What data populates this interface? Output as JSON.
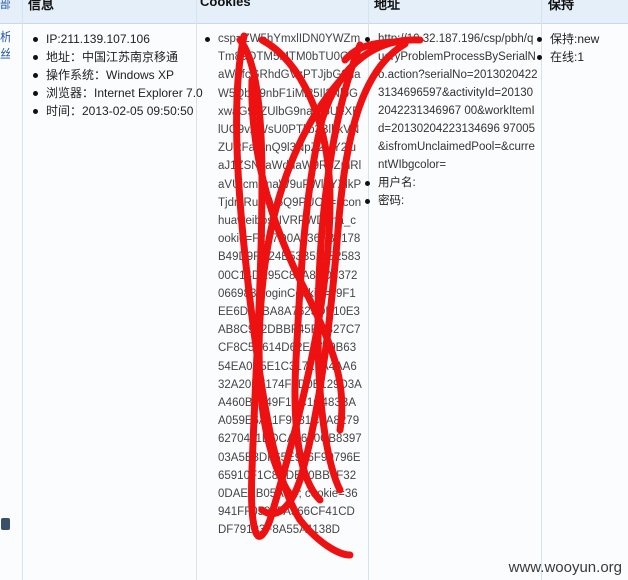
{
  "header": {
    "col_info": "信息",
    "col_cookies": "Cookies",
    "col_address": "地址",
    "col_keep": "保持"
  },
  "left_links": [
    "部",
    "析",
    "丝"
  ],
  "info": [
    "IP:211.139.107.106",
    "地址：中国江苏南京移通",
    "操作系统：Windows XP",
    "浏览器：Internet Explorer 7.0",
    "时间：2013-02-05 09:50:50"
  ],
  "cookies": "csp=ZW5hYmxlIDN0YWZmTm89OTM5MTM0bTU0G9naW5fcGRhdGVzPTJjbG9naW5QbG9nbF1iMl25Il2NlbGxwaG9uZUlbG9naW5UeXBlUG9vZWsU0PTljb3BlbkVNZURFaVlnQ9l3NpZ2luY2luaJ1ZSNzaWduaW9RpZmRlaVUjcmVnaW9uPWlhYXlkPTjdmRuSW5Q9PUC==; conhuaweibossIVRPWD; na_cookie=F207D0A836FB5178B49D9FD24B53B5298258300C14DE95C87A8ED8372066983; loginCookie=29F1EE6DA8BA8A7623DE10E3AB8C932DBBF45FEB27C7CF8C5B614D62E3789B6354EA0B5E1C3171FA4AA632A20B7174F0D0B129D3AA460B7949F1FC1C483BAA059E6A11F9981C2A82796270411DDCA6690CB839703A5E8DF65E996F90796E65910F1C8ADE50BB7F320DAEEB05AC4; cookie=36941FF0588FA566CF41CDDF79193F8A55A1138D",
  "address": {
    "url": "http://10.32.187.196/csp/pbh/queryProblemProcessBySerialNo.action?serialNo=20130204223134696597&activityId=201302042231346967 00&workItemId=20130204223134696 97005&isfromUnclaimedPool=&currentWIbgcolor=",
    "username_label": "用户名:",
    "password_label": "密码:"
  },
  "keep": [
    "保持:new",
    "在线:1"
  ],
  "watermark": "www.wooyun.org",
  "icons": {
    "side": "app-icon"
  },
  "colors": {
    "header_bg": "#e4effa",
    "scribble": "#ee1111"
  }
}
